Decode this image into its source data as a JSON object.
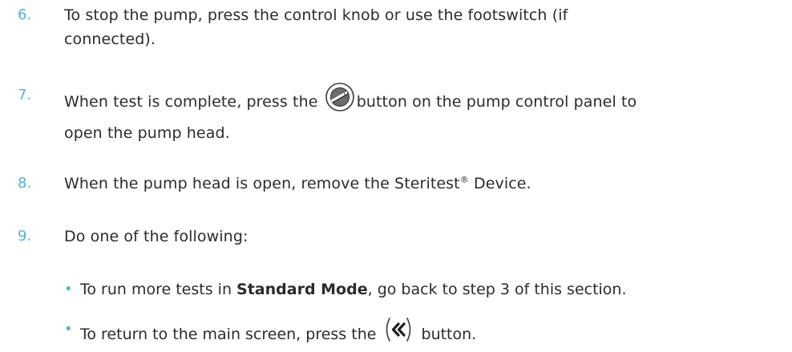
{
  "steps": [
    {
      "number": "6.",
      "line1": "To stop the pump, press the control knob or use the footswitch (if",
      "line2": "connected)."
    },
    {
      "number": "7.",
      "before_icon": "When test is complete, press the ",
      "icon": "pump-head-open-icon",
      "after_icon": "button on the pump control panel to",
      "line2": "open the pump head."
    },
    {
      "number": "8.",
      "before_mark": "When the pump head is open, remove the Steritest",
      "mark": "®",
      "after_mark": " Device."
    },
    {
      "number": "9.",
      "text": "Do one of the following:"
    }
  ],
  "bullets": [
    {
      "symbol": "•",
      "prefix": "To run more tests in ",
      "bold": "Standard Mode",
      "suffix": ", go back to step 3 of this section."
    },
    {
      "symbol": "•",
      "prefix": "To return to the main screen, press the ",
      "icon": "back-double-chevron-icon",
      "suffix": " button."
    }
  ],
  "colors": {
    "step_number": "#4fb3d9",
    "bullet": "#4fb3d9",
    "text": "#2b2b2b"
  }
}
